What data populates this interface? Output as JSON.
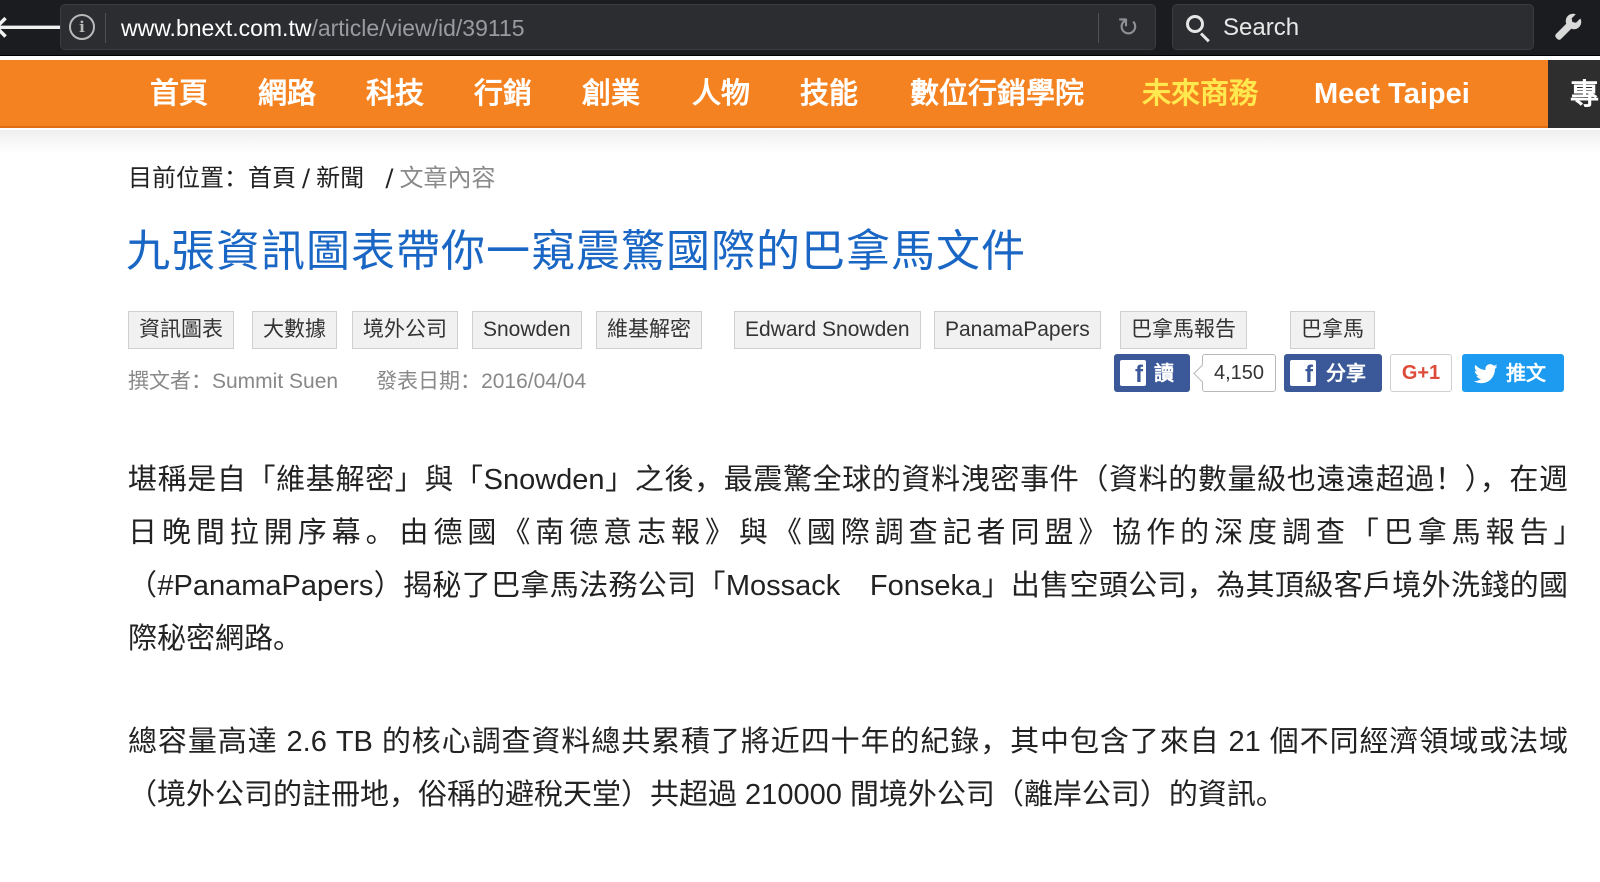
{
  "browser": {
    "url_domain": "www.bnext.com.tw",
    "url_path": "/article/view/id/39115",
    "search_placeholder": "Search",
    "back_glyph": "🡐",
    "info_glyph": "i",
    "reload_glyph": "↻",
    "wrench_glyph": "🔧"
  },
  "nav": {
    "items": [
      {
        "label": "首頁"
      },
      {
        "label": "網路"
      },
      {
        "label": "科技"
      },
      {
        "label": "行銷"
      },
      {
        "label": "創業"
      },
      {
        "label": "人物"
      },
      {
        "label": "技能"
      },
      {
        "label": "數位行銷學院"
      },
      {
        "label": "未來商務"
      },
      {
        "label": "Meet Taipei"
      }
    ],
    "more_label": "專",
    "highlight_color": "#ffe94f",
    "bar_color": "#f58220"
  },
  "breadcrumb": {
    "prefix": "目前位置：",
    "home": "首頁",
    "news": "新聞",
    "current": "文章內容"
  },
  "article": {
    "title": "九張資訊圖表帶你一窺震驚國際的巴拿馬文件",
    "tags": [
      "資訊圖表",
      "大數據",
      "境外公司",
      "Snowden",
      "維基解密",
      "Edward Snowden",
      "PanamaPapers",
      "巴拿馬報告",
      "巴拿馬"
    ],
    "author_label": "撰文者：",
    "author": "Summit Suen",
    "date_label": "發表日期：",
    "date": "2016/04/04",
    "paragraphs": [
      "堪稱是自「維基解密」與「Snowden」之後，最震驚全球的資料洩密事件（資料的數量級也遠遠超過！），在週日晚間拉開序幕。由德國《南德意志報》與《國際調查記者同盟》協作的深度調查「巴拿馬報告」　（#PanamaPapers）揭秘了巴拿馬法務公司「Mossack　Fonseka」出售空頭公司，為其頂級客戶境外洗錢的國際秘密網路。",
      "總容量高達 2.6 TB 的核心調查資料總共累積了將近四十年的紀錄，其中包含了來自 21 個不同經濟領域或法域（境外公司的註冊地，俗稱的避稅天堂）共超過 210000 間境外公司（離岸公司）的資訊。"
    ]
  },
  "social": {
    "fb_read_label": "讀",
    "fb_count": "4,150",
    "fb_share_label": "分享",
    "gplus_label": "G+1",
    "tweet_label": "推文",
    "fb_glyph": "f",
    "fb_color": "#3b5998",
    "twitter_color": "#1d9bf0",
    "gplus_color": "#dd4b39"
  },
  "colors": {
    "title_blue": "#1a66c4",
    "chrome_bg": "#1b1c1f"
  }
}
